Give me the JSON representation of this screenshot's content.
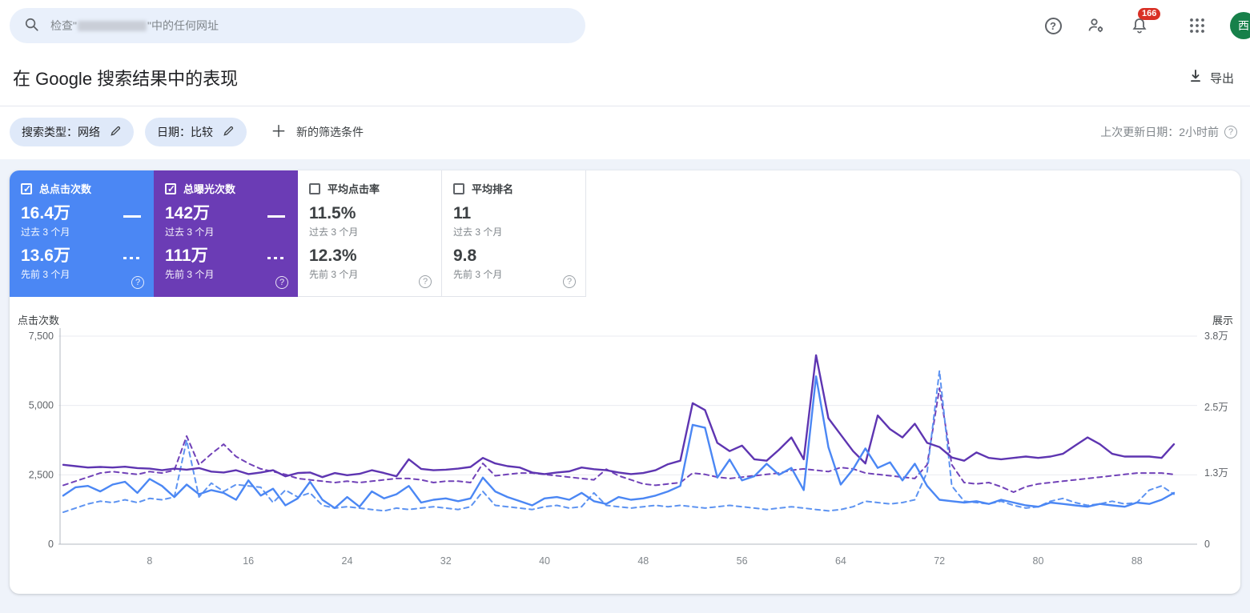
{
  "header": {
    "search": {
      "prefix": "检查\"",
      "suffix": "\"中的任何网址"
    },
    "notification_count": "166",
    "avatar_text": "西"
  },
  "page": {
    "title": "在 Google 搜索结果中的表现",
    "export_label": "导出"
  },
  "filters": {
    "chips": [
      {
        "label": "搜索类型：网络"
      },
      {
        "label": "日期：比较"
      }
    ],
    "new_filter_label": "新的筛选条件",
    "last_updated": "上次更新日期：2小时前"
  },
  "cards": [
    {
      "label": "总点击次数",
      "checked": true,
      "value_current": "16.4万",
      "period_current": "过去 3 个月",
      "value_previous": "13.6万",
      "period_previous": "先前 3 个月",
      "color": "#4b87f4"
    },
    {
      "label": "总曝光次数",
      "checked": true,
      "value_current": "142万",
      "period_current": "过去 3 个月",
      "value_previous": "111万",
      "period_previous": "先前 3 个月",
      "color": "#6b3cb5"
    },
    {
      "label": "平均点击率",
      "checked": false,
      "value_current": "11.5%",
      "period_current": "过去 3 个月",
      "value_previous": "12.3%",
      "period_previous": "先前 3 个月"
    },
    {
      "label": "平均排名",
      "checked": false,
      "value_current": "11",
      "period_current": "过去 3 个月",
      "value_previous": "9.8",
      "period_previous": "先前 3 个月"
    }
  ],
  "chart_data": {
    "type": "line",
    "days": 91,
    "ylabel_left": "点击次数",
    "ylabel_right": "展示",
    "grid": true,
    "legend_position": "none",
    "y_axis_left": {
      "max": 7500,
      "ticks": [
        {
          "value": 7500,
          "label": "7,500"
        },
        {
          "value": 5000,
          "label": "5,000"
        },
        {
          "value": 2500,
          "label": "2,500"
        },
        {
          "value": 0,
          "label": "0"
        }
      ]
    },
    "y_axis_right": {
      "max": 38000,
      "ticks": [
        {
          "value": 38000,
          "label": "3.8万"
        },
        {
          "value": 25000,
          "label": "2.5万"
        },
        {
          "value": 13000,
          "label": "1.3万"
        },
        {
          "value": 0,
          "label": "0"
        }
      ]
    },
    "x_axis": {
      "ticks": [
        {
          "value": 8,
          "label": "8"
        },
        {
          "value": 16,
          "label": "16"
        },
        {
          "value": 24,
          "label": "24"
        },
        {
          "value": 32,
          "label": "32"
        },
        {
          "value": 40,
          "label": "40"
        },
        {
          "value": 48,
          "label": "48"
        },
        {
          "value": 56,
          "label": "56"
        },
        {
          "value": 64,
          "label": "64"
        },
        {
          "value": 72,
          "label": "72"
        },
        {
          "value": 80,
          "label": "80"
        },
        {
          "value": 88,
          "label": "88"
        }
      ]
    },
    "series": [
      {
        "id": "impressions-current",
        "name": "总曝光次数 · 过去 3 个月",
        "axis": "right",
        "style": "solid",
        "color": "#5e35b1",
        "values": [
          14500,
          14250,
          14000,
          14100,
          14000,
          14150,
          13900,
          13800,
          13500,
          13800,
          13600,
          13900,
          13250,
          13100,
          13500,
          12800,
          13100,
          13500,
          12400,
          13000,
          13100,
          12250,
          13000,
          12600,
          12850,
          13500,
          13000,
          12400,
          15500,
          13750,
          13500,
          13600,
          13800,
          14100,
          15750,
          14750,
          14250,
          14000,
          13100,
          12800,
          13100,
          13300,
          14000,
          13700,
          13500,
          13100,
          12800,
          13000,
          13500,
          14600,
          15250,
          25750,
          24500,
          18500,
          17000,
          18000,
          15500,
          15250,
          17250,
          19500,
          15500,
          34500,
          23000,
          20000,
          17000,
          14750,
          23500,
          21000,
          19500,
          22000,
          18500,
          17750,
          15850,
          15250,
          16750,
          15750,
          15500,
          15750,
          16000,
          15750,
          16000,
          16500,
          18000,
          19500,
          18250,
          16500,
          16000,
          16000,
          16000,
          15750,
          18250
        ]
      },
      {
        "id": "impressions-previous",
        "name": "总曝光次数 · 先前 3 个月",
        "axis": "right",
        "style": "dashed",
        "color": "#7142b8",
        "values": [
          10750,
          11500,
          12250,
          13000,
          13250,
          13000,
          12750,
          13250,
          13000,
          13500,
          19750,
          14500,
          16500,
          18250,
          16000,
          14750,
          13750,
          13250,
          12750,
          12000,
          11750,
          11500,
          11250,
          11500,
          11250,
          11500,
          11750,
          12000,
          12000,
          11750,
          11250,
          11500,
          11500,
          11250,
          14750,
          12500,
          12750,
          13000,
          13000,
          12750,
          12500,
          12250,
          12000,
          11750,
          13700,
          12500,
          11750,
          11000,
          10750,
          11000,
          11250,
          13000,
          12750,
          12250,
          12000,
          12250,
          12500,
          12750,
          13000,
          13500,
          13750,
          13500,
          13250,
          14000,
          13750,
          13000,
          12750,
          12500,
          12250,
          12000,
          14500,
          28500,
          14500,
          11250,
          11000,
          11250,
          10500,
          9500,
          10500,
          11000,
          11250,
          11500,
          11750,
          12000,
          12250,
          12500,
          12750,
          13000,
          13000,
          13000,
          12750
        ]
      },
      {
        "id": "clicks-current",
        "name": "总点击次数 · 过去 3 个月",
        "axis": "left",
        "style": "solid",
        "color": "#4b87f4",
        "values": [
          1750,
          2050,
          2100,
          1900,
          2150,
          2250,
          1850,
          2350,
          2100,
          1700,
          2150,
          1800,
          1950,
          1850,
          1600,
          2300,
          1750,
          2000,
          1400,
          1650,
          2250,
          1600,
          1300,
          1700,
          1350,
          1900,
          1650,
          1800,
          2100,
          1500,
          1600,
          1650,
          1550,
          1650,
          2400,
          1900,
          1700,
          1550,
          1400,
          1650,
          1700,
          1600,
          1850,
          1550,
          1450,
          1700,
          1600,
          1650,
          1750,
          1900,
          2100,
          4300,
          4200,
          2400,
          3050,
          2300,
          2450,
          2900,
          2500,
          2750,
          1950,
          6050,
          3500,
          2150,
          2700,
          3450,
          2750,
          2950,
          2300,
          2900,
          2100,
          1600,
          1550,
          1500,
          1550,
          1450,
          1600,
          1500,
          1400,
          1350,
          1500,
          1450,
          1400,
          1350,
          1450,
          1400,
          1350,
          1500,
          1450,
          1600,
          1850
        ]
      },
      {
        "id": "clicks-previous",
        "name": "总点击次数 · 先前 3 个月",
        "axis": "left",
        "style": "dashed",
        "color": "#5d93f1",
        "values": [
          1150,
          1300,
          1450,
          1550,
          1500,
          1600,
          1500,
          1650,
          1600,
          1700,
          3750,
          1700,
          2200,
          1900,
          2150,
          2100,
          2050,
          1500,
          1950,
          1700,
          1850,
          1400,
          1300,
          1350,
          1300,
          1250,
          1200,
          1300,
          1250,
          1300,
          1350,
          1300,
          1250,
          1350,
          1900,
          1400,
          1350,
          1300,
          1250,
          1350,
          1400,
          1300,
          1350,
          1850,
          1400,
          1350,
          1300,
          1350,
          1400,
          1350,
          1400,
          1350,
          1300,
          1350,
          1400,
          1350,
          1300,
          1250,
          1300,
          1350,
          1300,
          1250,
          1200,
          1250,
          1350,
          1550,
          1500,
          1450,
          1500,
          1600,
          2600,
          6250,
          2100,
          1550,
          1500,
          1450,
          1550,
          1400,
          1300,
          1350,
          1550,
          1650,
          1500,
          1400,
          1450,
          1550,
          1450,
          1500,
          1950,
          2100,
          1800
        ]
      }
    ]
  }
}
